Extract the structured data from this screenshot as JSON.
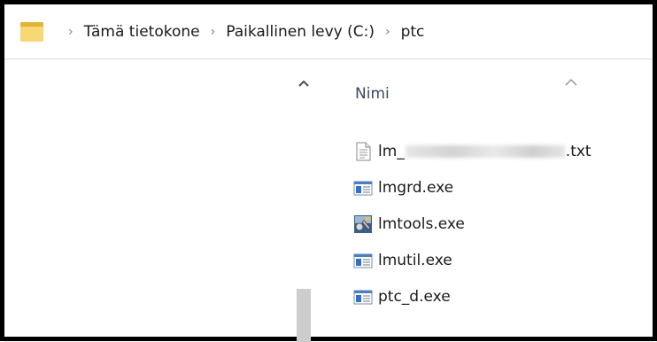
{
  "address_bar": {
    "folder_icon": "folder-icon",
    "separator_glyph": "›",
    "crumbs": [
      "Tämä tietokone",
      "Paikallinen levy (C:)",
      "ptc"
    ]
  },
  "nav_pane": {
    "scroll_up_icon": "chevron-up-icon"
  },
  "content": {
    "column_header": "Nimi",
    "sort_indicator": "chevron-up-icon",
    "files": [
      {
        "prefix": "lm_",
        "suffix": ".txt",
        "icon": "text-document-icon",
        "redacted": true
      },
      {
        "name": "lmgrd.exe",
        "icon": "application-window-icon"
      },
      {
        "name": "lmtools.exe",
        "icon": "lmtools-app-icon"
      },
      {
        "name": "lmutil.exe",
        "icon": "application-window-icon"
      },
      {
        "name": "ptc_d.exe",
        "icon": "application-window-icon"
      }
    ]
  },
  "colors": {
    "frame_border": "#000000",
    "folder_back": "#e2b435",
    "folder_front": "#f8d775",
    "header_text": "#3b4a63",
    "scroll_thumb": "#cdcdcd"
  }
}
